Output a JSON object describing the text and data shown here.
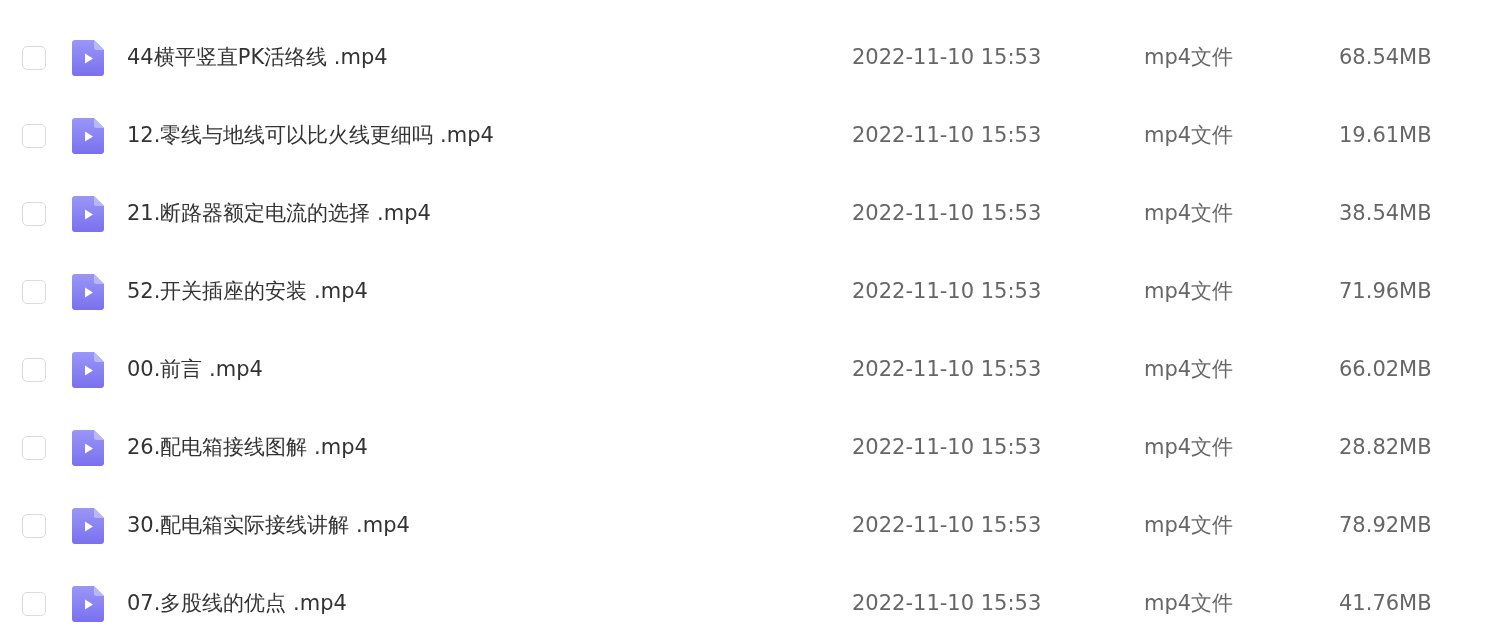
{
  "files": [
    {
      "checked": false,
      "name": "44横平竖直PK活络线 .mp4",
      "modified": "2022-11-10 15:53",
      "type": "mp4文件",
      "size": "68.54MB"
    },
    {
      "checked": false,
      "name": "12.零线与地线可以比火线更细吗 .mp4",
      "modified": "2022-11-10 15:53",
      "type": "mp4文件",
      "size": "19.61MB"
    },
    {
      "checked": false,
      "name": "21.断路器额定电流的选择 .mp4",
      "modified": "2022-11-10 15:53",
      "type": "mp4文件",
      "size": "38.54MB"
    },
    {
      "checked": false,
      "name": "52.开关插座的安装 .mp4",
      "modified": "2022-11-10 15:53",
      "type": "mp4文件",
      "size": "71.96MB"
    },
    {
      "checked": false,
      "name": "00.前言 .mp4",
      "modified": "2022-11-10 15:53",
      "type": "mp4文件",
      "size": "66.02MB"
    },
    {
      "checked": false,
      "name": "26.配电箱接线图解 .mp4",
      "modified": "2022-11-10 15:53",
      "type": "mp4文件",
      "size": "28.82MB"
    },
    {
      "checked": false,
      "name": "30.配电箱实际接线讲解 .mp4",
      "modified": "2022-11-10 15:53",
      "type": "mp4文件",
      "size": "78.92MB"
    },
    {
      "checked": false,
      "name": "07.多股线的优点 .mp4",
      "modified": "2022-11-10 15:53",
      "type": "mp4文件",
      "size": "41.76MB"
    }
  ]
}
